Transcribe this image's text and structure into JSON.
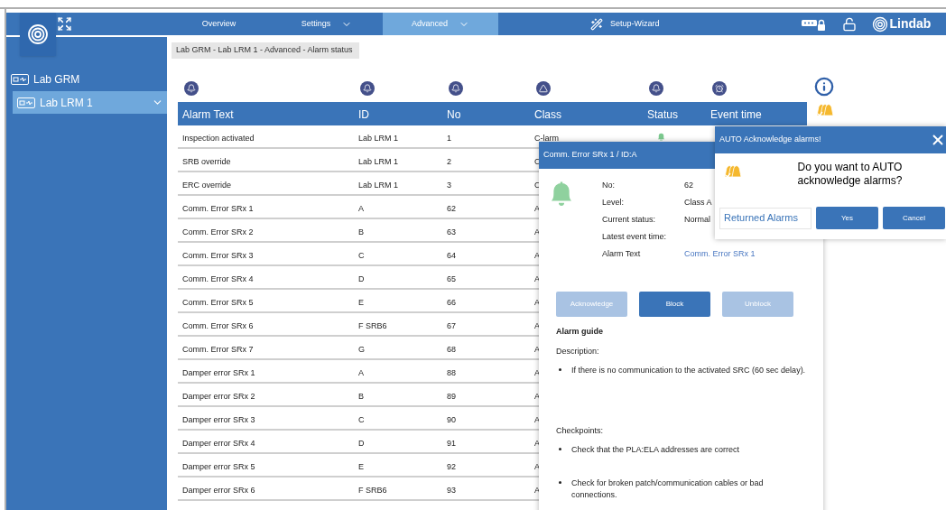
{
  "nav": {
    "tabs": [
      {
        "label": "Overview",
        "selected": false,
        "has_menu": false
      },
      {
        "label": "Settings",
        "selected": false,
        "has_menu": true
      },
      {
        "label": "Advanced",
        "selected": true,
        "has_menu": true
      }
    ],
    "wizard": "Setup-Wizard",
    "brand": "Lindab"
  },
  "sidebar": {
    "items": [
      {
        "label": "Lab GRM",
        "selected": false,
        "children": [
          {
            "label": "Lab LRM 1",
            "selected": true
          }
        ]
      }
    ]
  },
  "breadcrumb": "Lab GRM - Lab LRM 1 - Advanced - Alarm status",
  "table": {
    "columns": [
      {
        "label": "Alarm Text",
        "kind": "bell"
      },
      {
        "label": "ID",
        "kind": "bell"
      },
      {
        "label": "No",
        "kind": "bell"
      },
      {
        "label": "Class",
        "kind": "triangle"
      },
      {
        "label": "Status",
        "kind": "bell"
      },
      {
        "label": "Event time",
        "kind": "clock"
      }
    ],
    "rows": [
      {
        "alarm_text": "Inspection activated",
        "id": "Lab LRM 1",
        "no": "1",
        "class": "C-larm",
        "status_bell": true
      },
      {
        "alarm_text": "SRB override",
        "id": "Lab LRM 1",
        "no": "2",
        "class": "C"
      },
      {
        "alarm_text": "ERC override",
        "id": "Lab LRM 1",
        "no": "3",
        "class": "C"
      },
      {
        "alarm_text": "Comm. Error SRx 1",
        "id": "A",
        "no": "62",
        "class": "A"
      },
      {
        "alarm_text": "Comm. Error SRx 2",
        "id": "B",
        "no": "63",
        "class": "A"
      },
      {
        "alarm_text": "Comm. Error SRx 3",
        "id": "C",
        "no": "64",
        "class": "A"
      },
      {
        "alarm_text": "Comm. Error SRx 4",
        "id": "D",
        "no": "65",
        "class": "A"
      },
      {
        "alarm_text": "Comm. Error SRx 5",
        "id": "E",
        "no": "66",
        "class": "A"
      },
      {
        "alarm_text": "Comm. Error SRx 6",
        "id": "F SRB6",
        "no": "67",
        "class": "A"
      },
      {
        "alarm_text": "Comm. Error SRx 7",
        "id": "G",
        "no": "68",
        "class": "A"
      },
      {
        "alarm_text": "Damper error SRx 1",
        "id": "A",
        "no": "88",
        "class": "A"
      },
      {
        "alarm_text": "Damper error SRx 2",
        "id": "B",
        "no": "89",
        "class": "A"
      },
      {
        "alarm_text": "Damper error SRx 3",
        "id": "C",
        "no": "90",
        "class": "A"
      },
      {
        "alarm_text": "Damper error SRx 4",
        "id": "D",
        "no": "91",
        "class": "A"
      },
      {
        "alarm_text": "Damper error SRx 5",
        "id": "E",
        "no": "92",
        "class": "A"
      },
      {
        "alarm_text": "Damper error SRx 6",
        "id": "F SRB6",
        "no": "93",
        "class": "A"
      }
    ]
  },
  "detail_dialog": {
    "title": "Comm. Error SRx 1 / ID:A",
    "fields": [
      {
        "label": "No:",
        "value": "62",
        "link": false
      },
      {
        "label": "Level:",
        "value": "Class A",
        "link": false
      },
      {
        "label": "Current status:",
        "value": "Normal",
        "link": false
      },
      {
        "label": "Latest event time:"
      },
      {
        "label": "Alarm Text",
        "value": "Comm. Error SRx 1",
        "link": true
      }
    ],
    "buttons": [
      {
        "label": "Acknowledge",
        "disabled": true
      },
      {
        "label": "Block",
        "disabled": false
      },
      {
        "label": "Unblock",
        "disabled": true
      }
    ],
    "guide_title": "Alarm guide",
    "description_label": "Description:",
    "description_items": [
      "If there is no communication to the activated SRC (60 sec delay)."
    ],
    "checkpoints_label": "Checkpoints:",
    "checkpoints_items": [
      "Check that the PLA:ELA addresses are correct",
      "Check for broken patch/communication cables or bad connections."
    ]
  },
  "auto_dialog": {
    "title": "AUTO Acknowledge alarms!",
    "question": "Do you want to AUTO acknowledge alarms?",
    "returned": "Returned Alarms",
    "buttons": [
      "Yes",
      "Cancel"
    ]
  }
}
